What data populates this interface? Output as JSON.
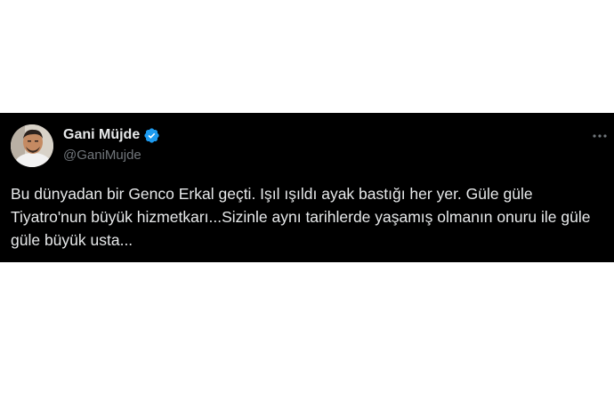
{
  "tweet": {
    "author": {
      "display_name": "Gani Müjde",
      "handle": "@GaniMujde",
      "verified": true,
      "avatar_icon": "profile-photo"
    },
    "text": "Bu dünyadan bir Genco Erkal geçti. Işıl ışıldı ayak bastığı her yer. Güle güle Tiyatro'nun büyük hizmetkarı...Sizinle aynı tarihlerde yaşamış olmanın onuru ile güle güle büyük usta...",
    "more_icon": "more-horizontal-icon"
  },
  "colors": {
    "card_background": "#000000",
    "page_background": "#ffffff",
    "primary_text": "#e7e9ea",
    "secondary_text": "#71767b",
    "verified_badge": "#1d9bf0"
  }
}
